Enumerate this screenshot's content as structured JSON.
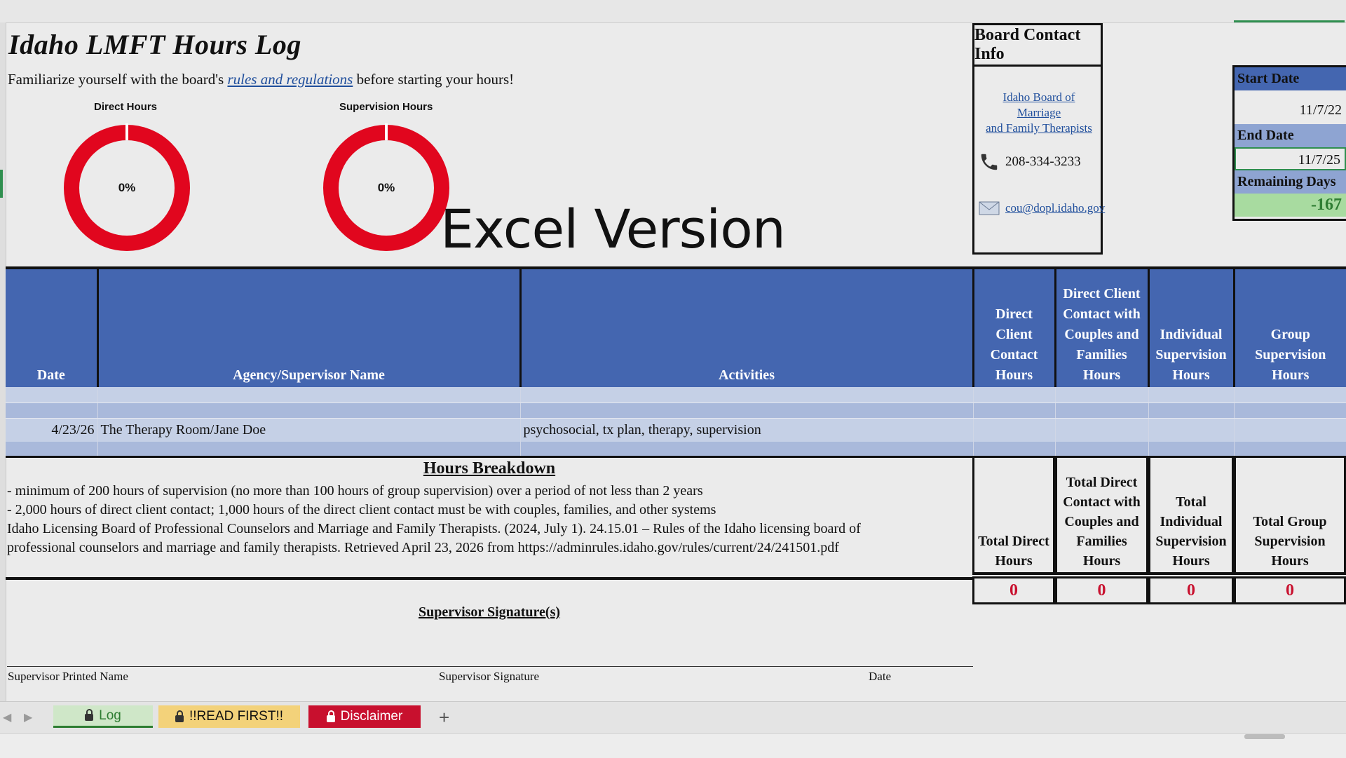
{
  "sheet": {
    "title": "Idaho LMFT Hours Log",
    "subtitle_pre": "Familiarize yourself with the board's ",
    "subtitle_link": "rules and regulations",
    "subtitle_post": " before starting your hours!",
    "overlay_text": "Excel Version"
  },
  "charts": {
    "direct": {
      "label": "Direct Hours",
      "percent_text": "0%",
      "value": 0
    },
    "supervision": {
      "label": "Supervision Hours",
      "percent_text": "0%",
      "value": 0
    }
  },
  "board": {
    "header": "Board Contact Info",
    "link_line1": "Idaho Board of Marriage",
    "link_line2": "and Family Therapists",
    "phone": "208-334-3233",
    "email": "cou@dopl.idaho.gov",
    "phone_icon": "phone-icon",
    "email_icon": "email-icon"
  },
  "dates": {
    "start_label": "Start Date",
    "start_value": "11/7/22",
    "end_label": "End Date",
    "end_value": "11/7/25",
    "remaining_label": "Remaining Days",
    "remaining_value": "-167"
  },
  "table": {
    "headers": [
      "Date",
      "Agency/Supervisor Name",
      "Activities",
      "Direct Client Contact Hours",
      "Direct Client Contact with Couples and Families Hours",
      "Individual Supervision Hours",
      "Group Supervision Hours"
    ],
    "entry": {
      "date": "4/23/26",
      "agency": "The Therapy Room/Jane Doe",
      "activities": "psychosocial, tx plan, therapy, supervision"
    }
  },
  "breakdown": {
    "heading": "Hours Breakdown",
    "line1": "- minimum of 200 hours of supervision (no more than 100 hours of group supervision) over a period of not less than 2 years",
    "line2": "- 2,000 hours of direct client contact; 1,000 hours of the direct client contact must be with couples, families, and other systems",
    "line3": "Idaho Licensing Board of Professional Counselors and Marriage and Family Therapists. (2024, July 1). 24.15.01 – Rules of the Idaho licensing board of",
    "line4": "professional counselors and marriage and family therapists. Retrieved April 23, 2026 from https://adminrules.idaho.gov/rules/current/24/241501.pdf"
  },
  "totals": {
    "labels": [
      "Total Direct Hours",
      "Total Direct Contact with Couples and Families Hours",
      "Total Individual Supervision Hours",
      "Total Group Supervision Hours"
    ],
    "values": [
      "0",
      "0",
      "0",
      "0"
    ]
  },
  "signature": {
    "heading": "Supervisor Signature(s)",
    "printed_name": "Supervisor Printed Name",
    "signature": "Supervisor Signature",
    "date": "Date"
  },
  "tabs": {
    "log": "Log",
    "read_first": "!!READ FIRST!!",
    "disclaimer": "Disclaimer",
    "add": "+",
    "prev": "◀",
    "next": "▶"
  },
  "colors": {
    "header_blue": "#4466b0",
    "donut_red": "#e1061e",
    "total_red": "#c8102e",
    "remaining_green": "#a8dba0"
  }
}
